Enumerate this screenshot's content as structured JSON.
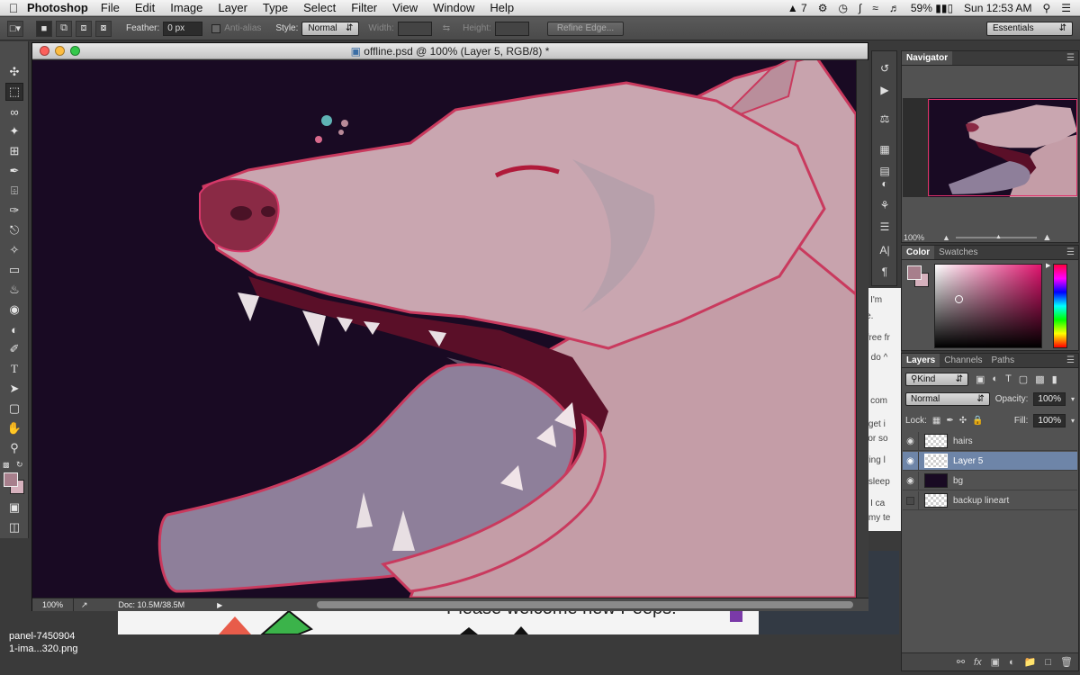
{
  "menubar": {
    "app_name": "Photoshop",
    "menus": [
      "File",
      "Edit",
      "Image",
      "Layer",
      "Type",
      "Select",
      "Filter",
      "View",
      "Window",
      "Help"
    ],
    "status": {
      "adobe_badge": "7",
      "battery": "59%",
      "clock": "Sun 12:53 AM"
    }
  },
  "options": {
    "feather_label": "Feather:",
    "feather_value": "0 px",
    "antialias_label": "Anti-alias",
    "style_label": "Style:",
    "style_value": "Normal",
    "width_label": "Width:",
    "height_label": "Height:",
    "refine_label": "Refine Edge...",
    "workspace": "Essentials"
  },
  "document": {
    "title": "offline.psd @ 100% (Layer 5, RGB/8) *",
    "zoom": "100%",
    "doc_info": "Doc: 10.5M/38.5M"
  },
  "navigator": {
    "tab": "Navigator",
    "zoom": "100%"
  },
  "color_panel": {
    "tabs": [
      "Color",
      "Swatches"
    ],
    "foreground": "#a77f8c",
    "background": "#d6b1bd"
  },
  "layers_panel": {
    "tabs": [
      "Layers",
      "Channels",
      "Paths"
    ],
    "filter": "Kind",
    "blend_mode": "Normal",
    "opacity_label": "Opacity:",
    "opacity": "100%",
    "lock_label": "Lock:",
    "fill_label": "Fill:",
    "fill": "100%",
    "layers": [
      {
        "name": "hairs",
        "visible": true,
        "active": false
      },
      {
        "name": "Layer 5",
        "visible": true,
        "active": true
      },
      {
        "name": "bg",
        "visible": true,
        "active": false
      },
      {
        "name": "backup lineart",
        "visible": false,
        "active": false
      }
    ]
  },
  "background_window": {
    "chat_lines": [
      "xt : I'm",
      "one.",
      "or free fr",
      "will do ^",
      "my com",
      "ou get i",
      "es or so",
      "earing l",
      "ng sleep",
      "xt : I ca",
      "en my te"
    ],
    "banner_text": "Please welcome new Peeps!"
  },
  "desktop_file": {
    "line1": "panel-7450904",
    "line2": "1-ima...320.png"
  }
}
